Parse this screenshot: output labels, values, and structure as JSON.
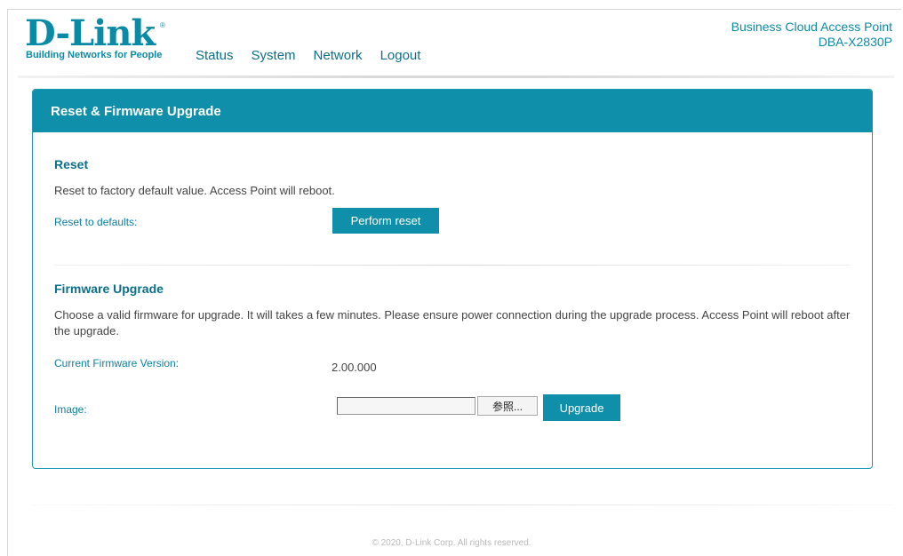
{
  "brand": {
    "logo_text": "D-Link",
    "registered": "®",
    "tagline": "Building Networks for People",
    "color": "#0b8aa6"
  },
  "nav": {
    "items": [
      {
        "label": "Status"
      },
      {
        "label": "System"
      },
      {
        "label": "Network"
      },
      {
        "label": "Logout"
      }
    ]
  },
  "product": {
    "line1": "Business Cloud Access Point",
    "line2": "DBA-X2830P"
  },
  "panel": {
    "title": "Reset & Firmware Upgrade",
    "header_color": "#0f8fa9"
  },
  "reset": {
    "title": "Reset",
    "description": "Reset to factory default value. Access Point will reboot.",
    "label": "Reset to defaults:",
    "button_label": "Perform reset"
  },
  "firmware": {
    "title": "Firmware Upgrade",
    "description": "Choose a valid firmware for upgrade. It will takes a few minutes. Please ensure power connection during the upgrade process. Access Point will reboot after the upgrade.",
    "current_version_label": "Current Firmware Version:",
    "current_version_value": "2.00.000",
    "image_label": "Image:",
    "file_input_value": "",
    "browse_label": "参照...",
    "upgrade_label": "Upgrade"
  },
  "footer": {
    "copyright": "© 2020, D-Link Corp. All rights reserved."
  }
}
